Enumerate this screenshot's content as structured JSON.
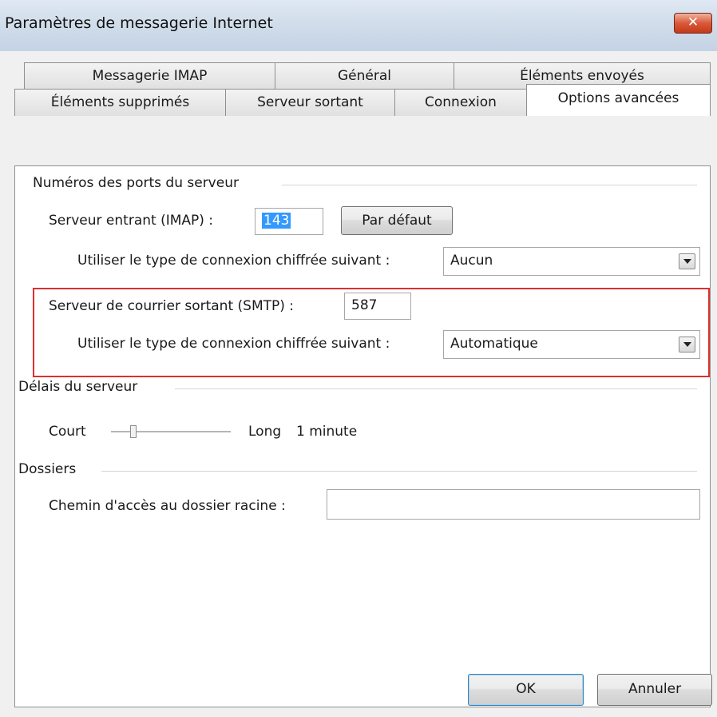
{
  "window": {
    "title": "Paramètres de messagerie Internet",
    "close_symbol": "✕"
  },
  "tabs": {
    "row1": [
      "Messagerie IMAP",
      "Général",
      "Éléments envoyés"
    ],
    "row2": [
      "Éléments supprimés",
      "Serveur sortant",
      "Connexion",
      "Options avancées"
    ],
    "active": "Options avancées"
  },
  "ports": {
    "group_label": "Numéros des ports du serveur",
    "incoming_label": "Serveur entrant (IMAP) :",
    "incoming_value": "143",
    "default_button": "Par défaut",
    "incoming_encryption_label": "Utiliser le type de connexion chiffrée suivant :",
    "incoming_encryption_value": "Aucun",
    "outgoing_label": "Serveur de courrier sortant (SMTP) :",
    "outgoing_value": "587",
    "outgoing_encryption_label": "Utiliser le type de connexion chiffrée suivant :",
    "outgoing_encryption_value": "Automatique"
  },
  "timeouts": {
    "group_label": "Délais du serveur",
    "short_label": "Court",
    "long_label": "Long",
    "value": "1 minute",
    "slider_fraction": 0.17
  },
  "folders": {
    "group_label": "Dossiers",
    "root_path_label": "Chemin d'accès au dossier racine :",
    "root_path_value": ""
  },
  "footer": {
    "ok_label": "OK",
    "cancel_label": "Annuler"
  },
  "colors": {
    "highlight_border": "#e02e2e",
    "selection": "#3399ff",
    "close_button": "#c9472a"
  }
}
